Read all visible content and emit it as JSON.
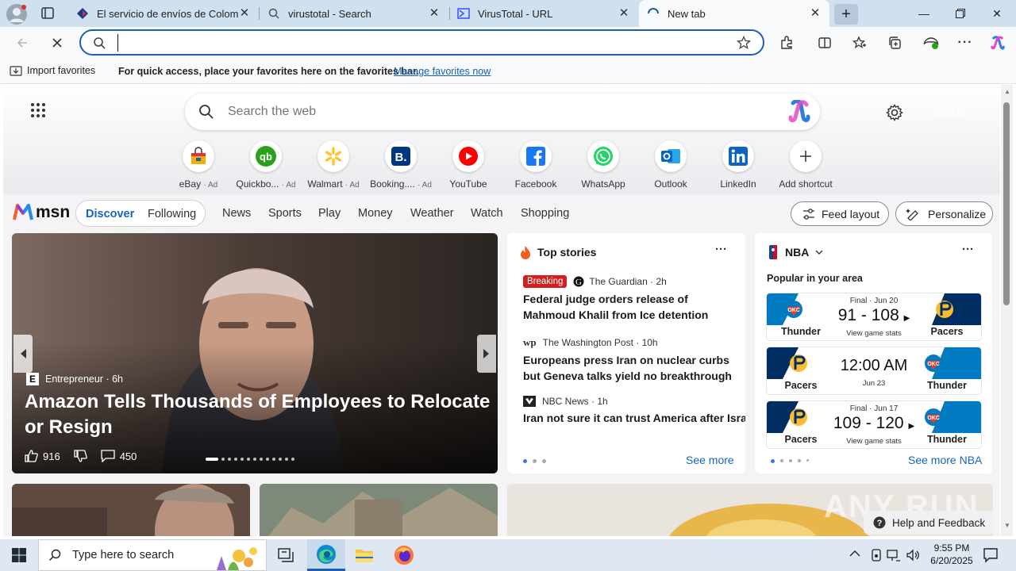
{
  "tabs": [
    {
      "title": "El servicio de envíos de Colombia",
      "icon": "document-icon"
    },
    {
      "title": "virustotal - Search",
      "icon": "search-icon"
    },
    {
      "title": "VirusTotal - URL",
      "icon": "virustotal-icon"
    },
    {
      "title": "New tab",
      "icon": "loading-icon"
    }
  ],
  "address": {
    "value": "",
    "placeholder": ""
  },
  "favbar": {
    "import": "Import favorites",
    "message": "For quick access, place your favorites here on the favorites bar.",
    "manage": "Manage favorites now"
  },
  "search": {
    "placeholder": "Search the web",
    "signin": "Sign in"
  },
  "shortcuts": [
    {
      "label": "eBay",
      "ad": "· Ad",
      "color": "#e53238"
    },
    {
      "label": "Quickbo...",
      "ad": "· Ad",
      "color": "#2ca01c"
    },
    {
      "label": "Walmart",
      "ad": "· Ad",
      "color": "#0071ce"
    },
    {
      "label": "Booking....",
      "ad": "· Ad",
      "color": "#003580"
    },
    {
      "label": "YouTube",
      "ad": "",
      "color": "#ff0000"
    },
    {
      "label": "Facebook",
      "ad": "",
      "color": "#1877f2"
    },
    {
      "label": "WhatsApp",
      "ad": "",
      "color": "#25d366"
    },
    {
      "label": "Outlook",
      "ad": "",
      "color": "#0a64c2"
    },
    {
      "label": "LinkedIn",
      "ad": "",
      "color": "#0a66c2"
    },
    {
      "label": "Add shortcut",
      "ad": "",
      "color": "#333333"
    }
  ],
  "msn": {
    "logo": "msn",
    "tabs": [
      "Discover",
      "Following"
    ],
    "nav": [
      "News",
      "Sports",
      "Play",
      "Money",
      "Weather",
      "Watch",
      "Shopping"
    ],
    "feed_layout": "Feed layout",
    "personalize": "Personalize"
  },
  "hero": {
    "source": "Entrepreneur",
    "age": "6h",
    "title": "Amazon Tells Thousands of Employees to Relocate or Resign",
    "likes": "916",
    "comments": "450"
  },
  "top_stories": {
    "header": "Top stories",
    "see_more": "See more",
    "items": [
      {
        "badge": "Breaking",
        "source": "The Guardian",
        "age": "· 2h",
        "title": "Federal judge orders release of Mahmoud Khalil from Ice detention"
      },
      {
        "badge": "",
        "source": "The Washington Post",
        "age": "· 10h",
        "title": "Europeans press Iran on nuclear curbs but Geneva talks yield no breakthrough"
      },
      {
        "badge": "",
        "source": "NBC News",
        "age": "· 1h",
        "title": "Iran not sure it can trust America after Israeli attack, Iran’s foreign minister tel..."
      }
    ]
  },
  "nba": {
    "header": "NBA",
    "popular": "Popular in your area",
    "see_more": "See more NBA",
    "games": [
      {
        "status": "Final · Jun 20",
        "score": "91 - 108",
        "sub": "View game stats",
        "left": "Thunder",
        "right": "Pacers"
      },
      {
        "status": "",
        "score": "12:00 AM",
        "sub": "Jun 23",
        "left": "Pacers",
        "right": "Thunder"
      },
      {
        "status": "Final · Jun 17",
        "score": "109 - 120",
        "sub": "View game stats",
        "left": "Pacers",
        "right": "Thunder"
      }
    ]
  },
  "watermark": "ANY RUN",
  "help": "Help and Feedback",
  "taskbar": {
    "search": "Type here to search",
    "time": "9:55 PM",
    "date": "6/20/2025"
  }
}
